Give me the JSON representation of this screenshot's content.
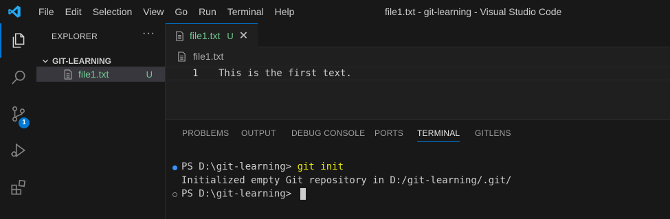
{
  "window": {
    "title": "file1.txt - git-learning - Visual Studio Code"
  },
  "menu": [
    "File",
    "Edit",
    "Selection",
    "View",
    "Go",
    "Run",
    "Terminal",
    "Help"
  ],
  "activity_bar": {
    "items": [
      "explorer-icon",
      "search-icon",
      "source-control-icon",
      "run-debug-icon",
      "extensions-icon"
    ],
    "source_control_badge": "1",
    "accent": "#0078d4"
  },
  "sidebar": {
    "title": "EXPLORER",
    "more": "···",
    "folder": "GIT-LEARNING",
    "files": [
      {
        "name": "file1.txt",
        "status": "U"
      }
    ],
    "untracked_color": "#73c991"
  },
  "editor": {
    "tab": {
      "name": "file1.txt",
      "status": "U",
      "close": "✕"
    },
    "breadcrumb": "file1.txt",
    "lines": [
      {
        "number": "1",
        "text": "This is the first text."
      }
    ]
  },
  "panel": {
    "tabs": [
      "PROBLEMS",
      "OUTPUT",
      "DEBUG CONSOLE",
      "PORTS",
      "TERMINAL",
      "GITLENS"
    ],
    "active_tab": "TERMINAL",
    "terminal": {
      "line1_prompt": "PS D:\\git-learning> ",
      "line1_command": "git init",
      "line2": "Initialized empty Git repository in D:/git-learning/.git/",
      "line3_prompt": "PS D:\\git-learning> "
    }
  }
}
